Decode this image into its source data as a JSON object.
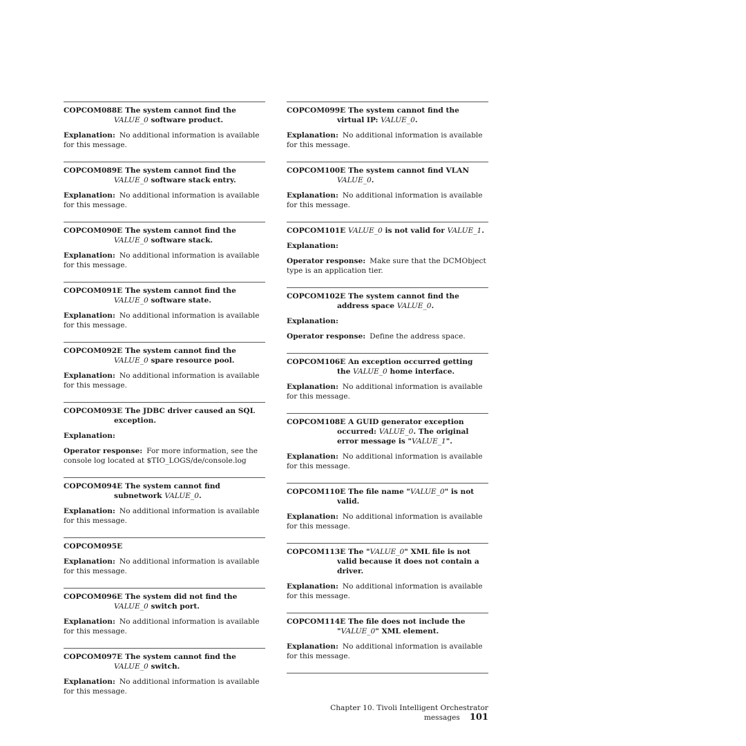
{
  "labels": {
    "explanation": "Explanation:",
    "operator_response": "Operator response:"
  },
  "columns": [
    {
      "messages": [
        {
          "code": "COPCOM088E",
          "title": [
            {
              "t": "The system cannot find the ",
              "i": false
            },
            {
              "t": "VALUE_0",
              "i": true
            },
            {
              "t": " software product.",
              "i": false
            }
          ],
          "explanation": "No additional information is available for this message."
        },
        {
          "code": "COPCOM089E",
          "title": [
            {
              "t": "The system cannot find the ",
              "i": false
            },
            {
              "t": "VALUE_0",
              "i": true
            },
            {
              "t": " software stack entry.",
              "i": false
            }
          ],
          "explanation": "No additional information is available for this message."
        },
        {
          "code": "COPCOM090E",
          "title": [
            {
              "t": "The system cannot find the ",
              "i": false
            },
            {
              "t": "VALUE_0",
              "i": true
            },
            {
              "t": " software stack.",
              "i": false
            }
          ],
          "explanation": "No additional information is available for this message."
        },
        {
          "code": "COPCOM091E",
          "title": [
            {
              "t": "The system cannot find the ",
              "i": false
            },
            {
              "t": "VALUE_0",
              "i": true
            },
            {
              "t": " software state.",
              "i": false
            }
          ],
          "explanation": "No additional information is available for this message."
        },
        {
          "code": "COPCOM092E",
          "title": [
            {
              "t": "The system cannot find the ",
              "i": false
            },
            {
              "t": "VALUE_0",
              "i": true
            },
            {
              "t": " spare resource pool.",
              "i": false
            }
          ],
          "explanation": "No additional information is available for this message."
        },
        {
          "code": "COPCOM093E",
          "title": [
            {
              "t": "The JDBC driver caused an SQL exception.",
              "i": false
            }
          ],
          "explanation": "",
          "operator_response": "For more information, see the console log located at $TIO_LOGS/de/console.log"
        },
        {
          "code": "COPCOM094E",
          "title": [
            {
              "t": "The system cannot find subnetwork ",
              "i": false
            },
            {
              "t": "VALUE_0",
              "i": true
            },
            {
              "t": ".",
              "i": false
            }
          ],
          "explanation": "No additional information is available for this message."
        },
        {
          "code": "COPCOM095E",
          "title": [],
          "explanation": "No additional information is available for this message."
        },
        {
          "code": "COPCOM096E",
          "title": [
            {
              "t": "The system did not find the ",
              "i": false
            },
            {
              "t": "VALUE_0",
              "i": true
            },
            {
              "t": " switch port.",
              "i": false
            }
          ],
          "explanation": "No additional information is available for this message."
        },
        {
          "code": "COPCOM097E",
          "title": [
            {
              "t": "The system cannot find the ",
              "i": false
            },
            {
              "t": "VALUE_0",
              "i": true
            },
            {
              "t": " switch.",
              "i": false
            }
          ],
          "explanation": "No additional information is available for this message."
        }
      ]
    },
    {
      "messages": [
        {
          "code": "COPCOM099E",
          "title": [
            {
              "t": "The system cannot find the virtual IP: ",
              "i": false
            },
            {
              "t": "VALUE_0",
              "i": true
            },
            {
              "t": ".",
              "i": false
            }
          ],
          "explanation": "No additional information is available for this message."
        },
        {
          "code": "COPCOM100E",
          "title": [
            {
              "t": "The system cannot find VLAN ",
              "i": false
            },
            {
              "t": "VALUE_0",
              "i": true
            },
            {
              "t": ".",
              "i": false
            }
          ],
          "explanation": "No additional information is available for this message."
        },
        {
          "code": "COPCOM101E",
          "title": [
            {
              "t": "VALUE_0",
              "i": true
            },
            {
              "t": " is not valid for ",
              "i": false
            },
            {
              "t": "VALUE_1",
              "i": true
            },
            {
              "t": ".",
              "i": false
            }
          ],
          "explanation": "",
          "operator_response": "Make sure that the DCMObject type is an application tier."
        },
        {
          "code": "COPCOM102E",
          "title": [
            {
              "t": "The system cannot find the address space ",
              "i": false
            },
            {
              "t": "VALUE_0",
              "i": true
            },
            {
              "t": ".",
              "i": false
            }
          ],
          "explanation": "",
          "operator_response": "Define the address space."
        },
        {
          "code": "COPCOM106E",
          "title": [
            {
              "t": "An exception occurred getting the ",
              "i": false
            },
            {
              "t": "VALUE_0",
              "i": true
            },
            {
              "t": " home interface.",
              "i": false
            }
          ],
          "explanation": "No additional information is available for this message."
        },
        {
          "code": "COPCOM108E",
          "title": [
            {
              "t": "A GUID generator exception occurred: ",
              "i": false
            },
            {
              "t": "VALUE_0",
              "i": true
            },
            {
              "t": ". The original error message is \"",
              "i": false
            },
            {
              "t": "VALUE_1",
              "i": true
            },
            {
              "t": "\".",
              "i": false
            }
          ],
          "explanation": "No additional information is available for this message."
        },
        {
          "code": "COPCOM110E",
          "title": [
            {
              "t": "The file name \"",
              "i": false
            },
            {
              "t": "VALUE_0",
              "i": true
            },
            {
              "t": "\" is not valid.",
              "i": false
            }
          ],
          "explanation": "No additional information is available for this message."
        },
        {
          "code": "COPCOM113E",
          "title": [
            {
              "t": "The \"",
              "i": false
            },
            {
              "t": "VALUE_0",
              "i": true
            },
            {
              "t": "\" XML file is not valid because it does not contain a driver.",
              "i": false
            }
          ],
          "explanation": "No additional information is available for this message."
        },
        {
          "code": "COPCOM114E",
          "title": [
            {
              "t": "The file does not include the \"",
              "i": false
            },
            {
              "t": "VALUE_0",
              "i": true
            },
            {
              "t": "\" XML element.",
              "i": false
            }
          ],
          "explanation": "No additional information is available for this message."
        }
      ]
    }
  ],
  "footer": {
    "chapter": "Chapter 10. Tivoli Intelligent Orchestrator messages",
    "page_number": "101"
  }
}
